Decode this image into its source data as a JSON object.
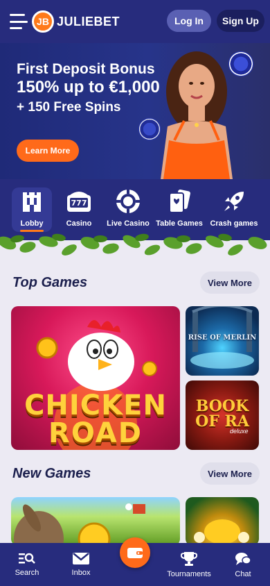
{
  "header": {
    "brand": "JULIEBET",
    "brand_mark": "JB",
    "login_label": "Log In",
    "signup_label": "Sign Up"
  },
  "hero": {
    "title": "First Deposit Bonus",
    "amount": "150% up to €1,000",
    "spins": "+ 150 Free Spins",
    "cta_label": "Learn More"
  },
  "categories": [
    {
      "label": "Lobby",
      "icon": "castle-icon",
      "active": true
    },
    {
      "label": "Casino",
      "icon": "slot-machine-icon",
      "reels": "777"
    },
    {
      "label": "Live Casino",
      "icon": "casino-chip-icon"
    },
    {
      "label": "Table Games",
      "icon": "playing-cards-icon"
    },
    {
      "label": "Crash games",
      "icon": "rocket-icon"
    }
  ],
  "sections": {
    "top_games": {
      "title": "Top Games",
      "view_more": "View More",
      "games": [
        {
          "name_line1": "CHICKEN",
          "name_line2": "ROAD"
        },
        {
          "name": "RISE OF MERLIN"
        },
        {
          "name_line1": "BOOK",
          "name_line2": "OF RA",
          "sub": "deluxe"
        }
      ]
    },
    "new_games": {
      "title": "New Games",
      "view_more": "View More"
    }
  },
  "bottom_nav": [
    {
      "label": "Search",
      "icon": "search-icon"
    },
    {
      "label": "Inbox",
      "icon": "envelope-icon"
    },
    {
      "label": "",
      "icon": "wallet-icon"
    },
    {
      "label": "Tournaments",
      "icon": "trophy-icon"
    },
    {
      "label": "Chat",
      "icon": "chat-bubble-icon"
    }
  ],
  "colors": {
    "brand_navy": "#272c7d",
    "accent_orange": "#ff6a1a",
    "page_bg": "#eceaf3"
  }
}
